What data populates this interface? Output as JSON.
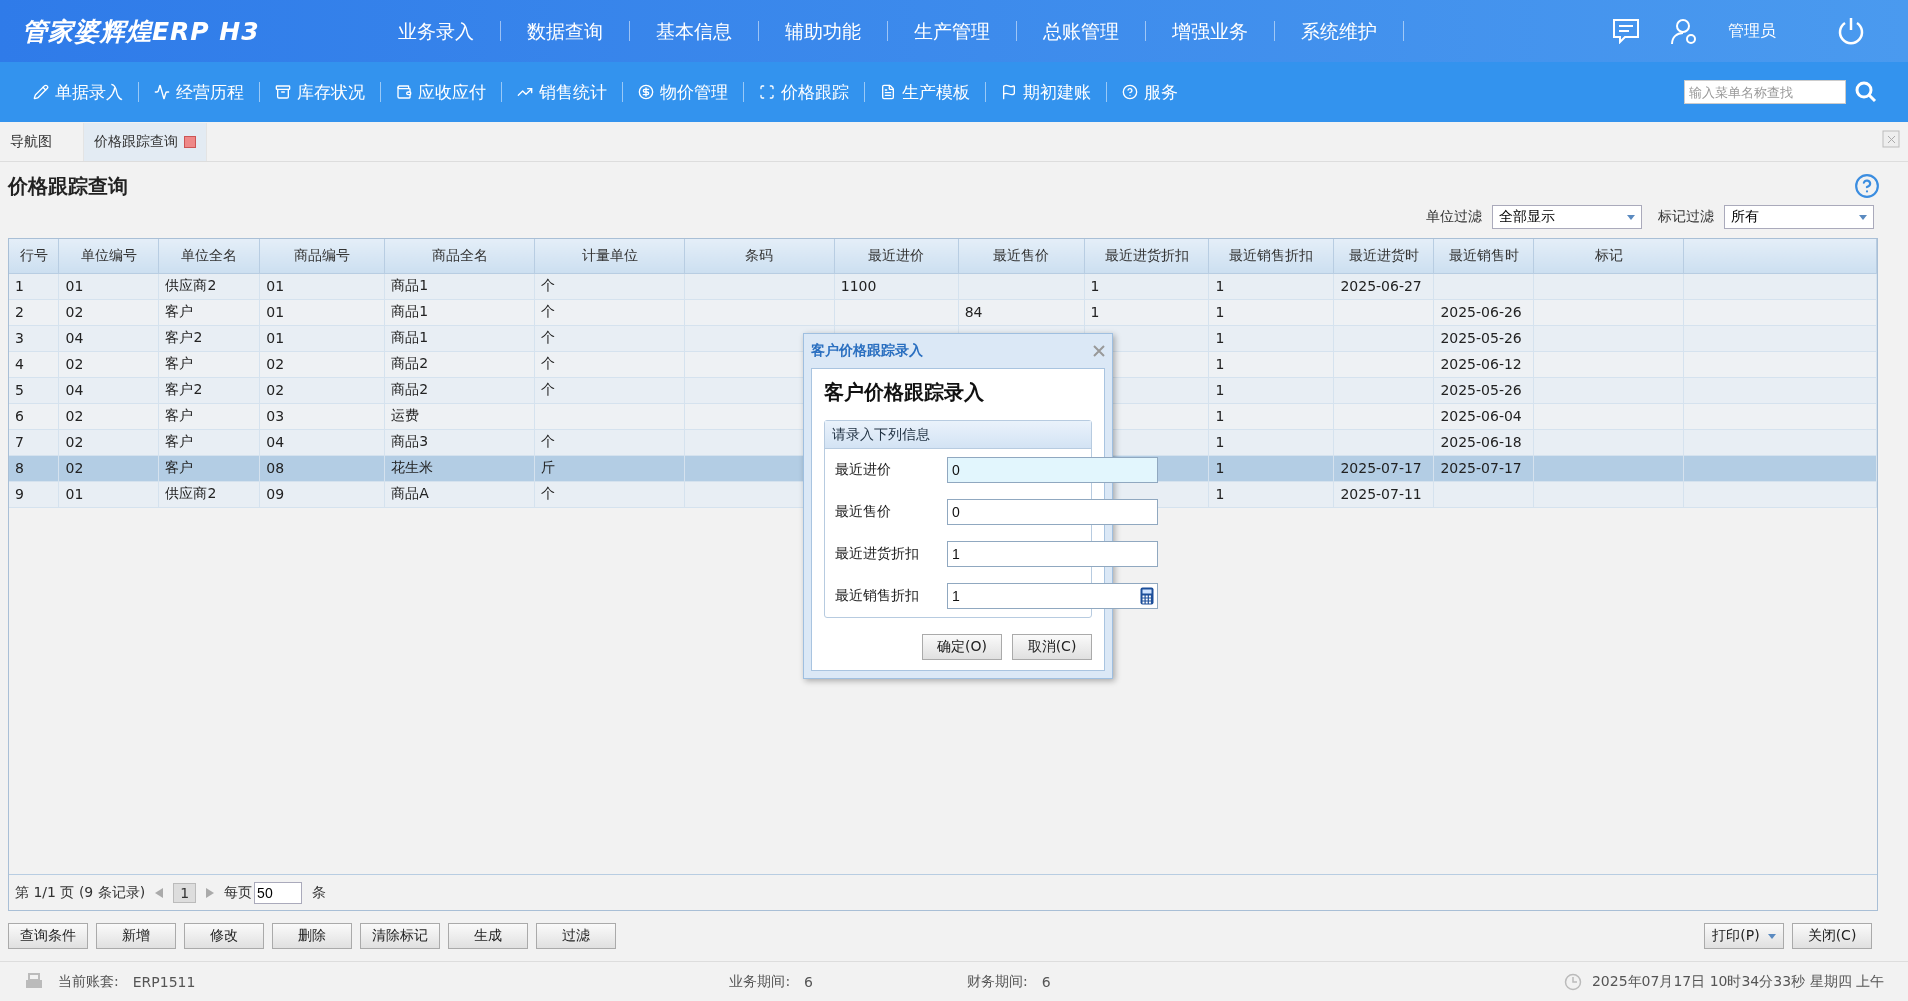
{
  "header": {
    "logo": "管家婆辉煌ERP H3",
    "menu": [
      "业务录入",
      "数据查询",
      "基本信息",
      "辅助功能",
      "生产管理",
      "总账管理",
      "增强业务",
      "系统维护"
    ],
    "user": "管理员"
  },
  "toolbar": {
    "items": [
      "单据录入",
      "经营历程",
      "库存状况",
      "应收应付",
      "销售统计",
      "物价管理",
      "价格跟踪",
      "生产模板",
      "期初建账",
      "服务"
    ],
    "search": {
      "placeholder": "输入菜单名称查找"
    }
  },
  "tabs": [
    {
      "label": "导航图",
      "selected": false
    },
    {
      "label": "价格跟踪查询",
      "selected": true
    }
  ],
  "page_title": "价格跟踪查询",
  "filters": [
    {
      "label": "单位过滤",
      "value": "全部显示"
    },
    {
      "label": "标记过滤",
      "value": "所有"
    }
  ],
  "table": {
    "columns": [
      "行号",
      "单位编号",
      "单位全名",
      "商品编号",
      "商品全名",
      "计量单位",
      "条码",
      "最近进价",
      "最近售价",
      "最近进货折扣",
      "最近销售折扣",
      "最近进货时",
      "最近销售时",
      "标记"
    ],
    "rows": [
      {
        "selected": false,
        "cells": [
          "1",
          "01",
          "供应商2",
          "01",
          "商品1",
          "个",
          null,
          "1100",
          null,
          "1",
          "1",
          "2025-06-27",
          null,
          null
        ]
      },
      {
        "selected": false,
        "cells": [
          "2",
          "02",
          "客户",
          "01",
          "商品1",
          "个",
          null,
          null,
          "84",
          "1",
          "1",
          null,
          "2025-06-26",
          null
        ]
      },
      {
        "selected": false,
        "cells": [
          "3",
          "04",
          "客户2",
          "01",
          "商品1",
          "个",
          null,
          null,
          null,
          null,
          "1",
          null,
          "2025-05-26",
          null
        ]
      },
      {
        "selected": false,
        "cells": [
          "4",
          "02",
          "客户",
          "02",
          "商品2",
          "个",
          null,
          null,
          null,
          null,
          "1",
          null,
          "2025-06-12",
          null
        ]
      },
      {
        "selected": false,
        "cells": [
          "5",
          "04",
          "客户2",
          "02",
          "商品2",
          "个",
          null,
          null,
          null,
          null,
          "1",
          null,
          "2025-05-26",
          null
        ]
      },
      {
        "selected": false,
        "cells": [
          "6",
          "02",
          "客户",
          "03",
          "运费",
          null,
          null,
          null,
          null,
          null,
          "1",
          null,
          "2025-06-04",
          null
        ]
      },
      {
        "selected": false,
        "cells": [
          "7",
          "02",
          "客户",
          "04",
          "商品3",
          "个",
          null,
          null,
          null,
          null,
          "1",
          null,
          "2025-06-18",
          null
        ]
      },
      {
        "selected": true,
        "cells": [
          "8",
          "02",
          "客户",
          "08",
          "花生米",
          "斤",
          null,
          null,
          null,
          null,
          "1",
          "2025-07-17",
          "2025-07-17",
          null
        ]
      },
      {
        "selected": false,
        "cells": [
          "9",
          "01",
          "供应商2",
          "09",
          "商品A",
          "个",
          null,
          null,
          null,
          null,
          "1",
          "2025-07-11",
          null,
          null
        ]
      }
    ]
  },
  "pagination": {
    "summary": "第 1/1 页 (9 条记录)",
    "page": "1",
    "per_page_label": "每页",
    "per_page": "50",
    "unit": "条"
  },
  "actions": [
    "查询条件",
    "新增",
    "修改",
    "删除",
    "清除标记",
    "生成",
    "过滤"
  ],
  "right_actions": [
    {
      "label": "打印(P)",
      "dropdown": true
    },
    {
      "label": "关闭(C)",
      "dropdown": false
    }
  ],
  "status_bar": {
    "account_label": "当前账套:",
    "account": "ERP1511",
    "business_period_label": "业务期间:",
    "business_period": "6",
    "finance_period_label": "财务期间:",
    "finance_period": "6",
    "datetime": "2025年07月17日 10时34分33秒 星期四 上午"
  },
  "dialog": {
    "title": "客户价格跟踪录入",
    "heading": "客户价格跟踪录入",
    "group_title": "请录入下列信息",
    "fields": [
      {
        "label": "最近进价",
        "value": "0",
        "focused": true,
        "calculator": false
      },
      {
        "label": "最近售价",
        "value": "0",
        "focused": false,
        "calculator": false
      },
      {
        "label": "最近进货折扣",
        "value": "1",
        "focused": false,
        "calculator": false
      },
      {
        "label": "最近销售折扣",
        "value": "1",
        "focused": false,
        "calculator": true
      }
    ],
    "buttons": [
      "确定(O)",
      "取消(C)"
    ]
  }
}
